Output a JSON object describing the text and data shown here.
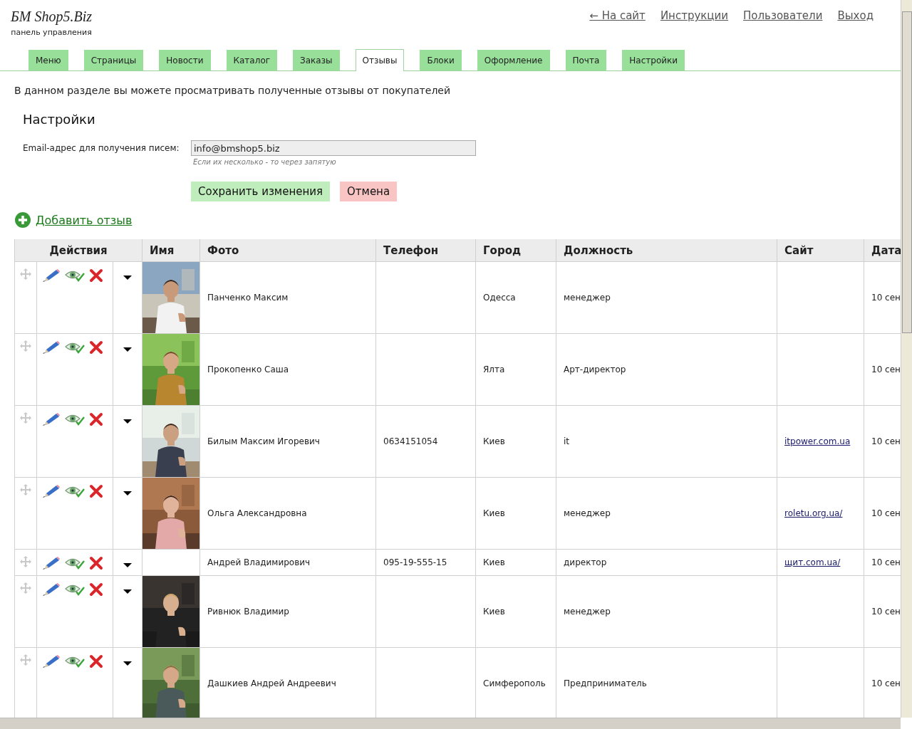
{
  "brand": {
    "title": "БМ Shop5.Biz",
    "subtitle": "панель управления"
  },
  "top_links": [
    "← На сайт",
    "Инструкции",
    "Пользователи",
    "Выход"
  ],
  "tabs": [
    {
      "label": "Меню",
      "selected": false
    },
    {
      "label": "Страницы",
      "selected": false
    },
    {
      "label": "Новости",
      "selected": false
    },
    {
      "label": "Каталог",
      "selected": false
    },
    {
      "label": "Заказы",
      "selected": false
    },
    {
      "label": "Отзывы",
      "selected": true
    },
    {
      "label": "Блоки",
      "selected": false
    },
    {
      "label": "Оформление",
      "selected": false
    },
    {
      "label": "Почта",
      "selected": false
    },
    {
      "label": "Настройки",
      "selected": false
    }
  ],
  "intro": "В данном разделе вы можете просматривать полученные отзывы от покупателей",
  "settings": {
    "heading": "Настройки",
    "email_label": "Email-адрес для получения писем:",
    "email_value": "info@bmshop5.biz",
    "hint": "Если их несколько - то через запятую",
    "save": "Сохранить изменения",
    "cancel": "Отмена"
  },
  "add_link": "Добавить отзыв",
  "table": {
    "columns": [
      "Действия",
      "Имя",
      "Фото",
      "Телефон",
      "Город",
      "Должность",
      "Сайт",
      "Дата"
    ],
    "rows": [
      {
        "name": "Панченко Максим",
        "city": "Одесса",
        "position": "менеджер",
        "date": "10 сен"
      },
      {
        "name": "Прокопенко Саша",
        "city": "Ялта",
        "position": "Арт-директор",
        "date": "10 сен"
      },
      {
        "name": "Билым Максим Игоревич",
        "phone": "0634151054",
        "city": "Киев",
        "position": "it",
        "site": "itpower.com.ua",
        "date": "10 сен"
      },
      {
        "name": "Ольга Александровна",
        "city": "Киев",
        "position": "менеджер",
        "site": "roletu.org.ua/",
        "date": "10 сен"
      },
      {
        "name": "Андрей Владимирович",
        "phone": "095-19-555-15",
        "city": "Киев",
        "position": "директор",
        "site": "щит.com.ua/",
        "date": "10 сен"
      },
      {
        "name": "Ривнюк Владимир",
        "city": "Киев",
        "position": "менеджер",
        "date": "10 сен"
      },
      {
        "name": "Дашкиев Андрей Андреевич",
        "city": "Симферополь",
        "position": "Предприниматель",
        "date": "10 сен"
      }
    ]
  }
}
